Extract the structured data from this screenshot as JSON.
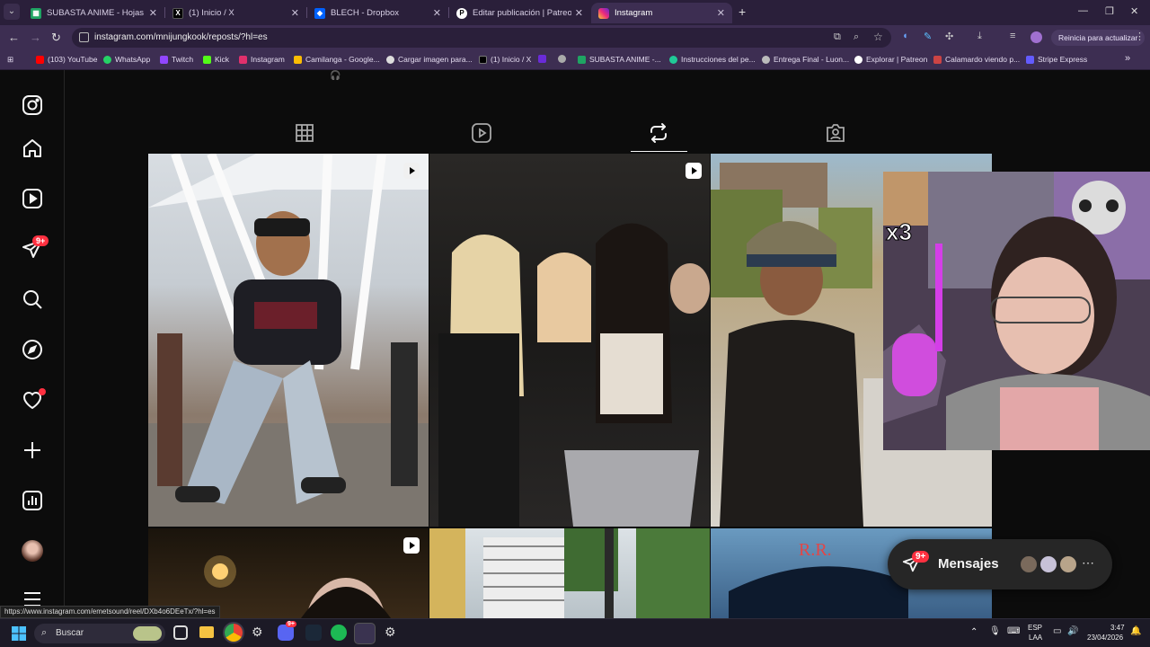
{
  "browser": {
    "tabs": [
      {
        "title": "SUBASTA ANIME - Hojas de cál",
        "favicon": "sheets-icon"
      },
      {
        "title": "(1) Inicio / X",
        "favicon": "x-icon"
      },
      {
        "title": "BLECH - Dropbox",
        "favicon": "dropbox-icon"
      },
      {
        "title": "Editar publicación | Patreon",
        "favicon": "patreon-icon"
      },
      {
        "title": "Instagram",
        "favicon": "instagram-icon",
        "active": true
      }
    ],
    "url": "instagram.com/mnijungkook/reposts/?hl=es",
    "update_button": "Reinicia para actualizar",
    "bookmarks": [
      "(103) YouTube",
      "WhatsApp",
      "Twitch",
      "Kick",
      "Instagram",
      "Camilanga - Google...",
      "Cargar imagen para...",
      "(1) Inicio / X",
      "",
      "",
      "SUBASTA ANIME -...",
      "Instrucciones del pe...",
      "Entrega Final - Luon...",
      "Explorar | Patreon",
      "Calamardo viendo p...",
      "Stripe Express"
    ]
  },
  "sidebar": {
    "items": [
      {
        "icon": "instagram-logo-icon"
      },
      {
        "icon": "home-icon"
      },
      {
        "icon": "reels-icon"
      },
      {
        "icon": "messages-icon",
        "badge": "9+"
      },
      {
        "icon": "search-icon"
      },
      {
        "icon": "explore-icon"
      },
      {
        "icon": "notifications-heart-icon",
        "dot": true
      },
      {
        "icon": "create-plus-icon"
      },
      {
        "icon": "dashboard-icon"
      },
      {
        "icon": "profile-avatar"
      },
      {
        "icon": "more-menu-icon"
      }
    ]
  },
  "profile_tabs": [
    {
      "icon": "grid-icon"
    },
    {
      "icon": "reels-tab-icon"
    },
    {
      "icon": "reposts-icon",
      "active": true
    },
    {
      "icon": "tagged-icon"
    }
  ],
  "overlay": {
    "meme_text": "x3"
  },
  "messages_bar": {
    "label": "Mensajes",
    "badge": "9+"
  },
  "status_url": "https://www.instagram.com/emetsound/reel/DXb4o6DEeTx/?hl=es",
  "taskbar": {
    "search_label": "Buscar",
    "language": "ESP",
    "layout": "LAA",
    "time": "3:47",
    "date": "23/04/2026",
    "discord_badge": "9+"
  }
}
